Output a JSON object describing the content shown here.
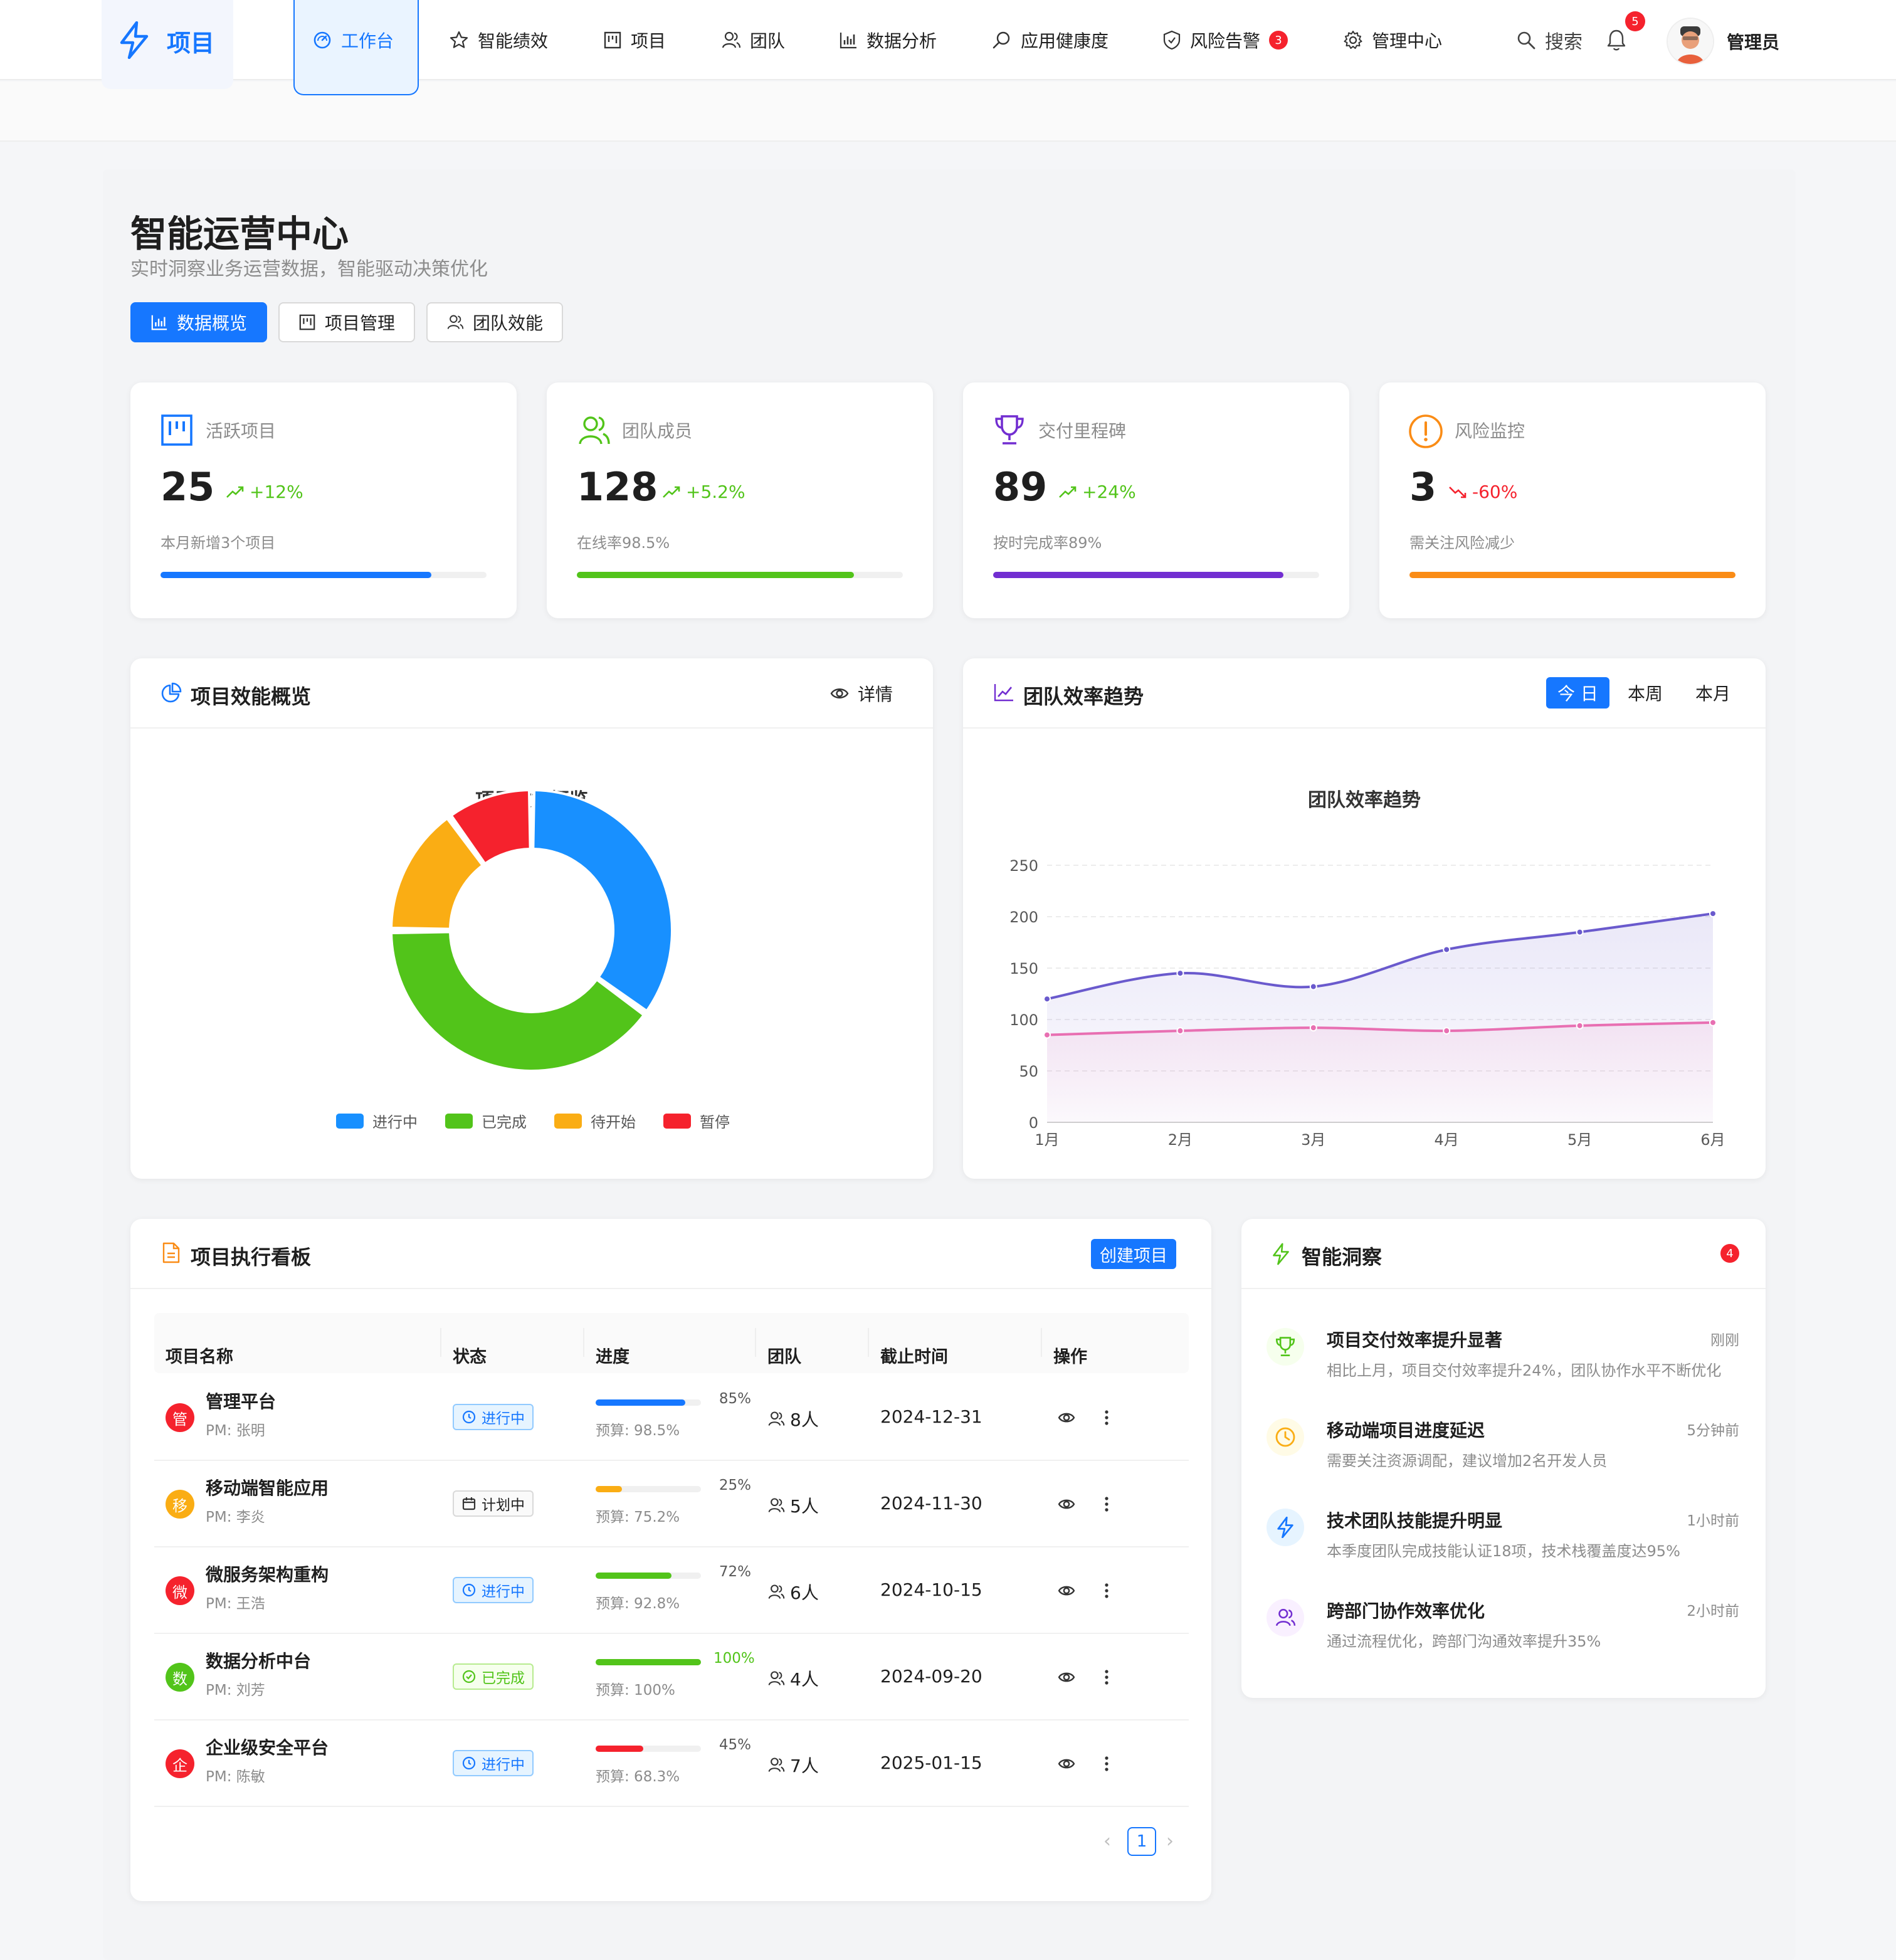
{
  "nav": {
    "logo": "项目",
    "items": [
      {
        "label": "工作台",
        "icon": "dashboard-icon"
      },
      {
        "label": "智能绩效",
        "icon": "star-icon"
      },
      {
        "label": "项目",
        "icon": "project-icon"
      },
      {
        "label": "团队",
        "icon": "team-icon"
      },
      {
        "label": "数据分析",
        "icon": "bar-chart-icon"
      },
      {
        "label": "应用健康度",
        "icon": "monitor-icon"
      },
      {
        "label": "风险告警",
        "icon": "shield-icon",
        "badge": "3"
      },
      {
        "label": "管理中心",
        "icon": "gear-icon"
      }
    ],
    "search": "搜索",
    "bell_badge": "5",
    "user": "管理员",
    "accent": "#1677ff"
  },
  "page": {
    "title": "智能运营中心",
    "subtitle": "实时洞察业务运营数据，智能驱动决策优化",
    "tabs": [
      "数据概览",
      "项目管理",
      "团队效能"
    ]
  },
  "kpis": [
    {
      "label": "活跃项目",
      "value": "25",
      "trend": "+12%",
      "trend_dir": "up",
      "note": "本月新增3个项目",
      "progress": 0.83,
      "color": "#1677ff"
    },
    {
      "label": "团队成员",
      "value": "128",
      "trend": "+5.2%",
      "trend_dir": "up",
      "note": "在线率98.5%",
      "progress": 0.85,
      "color": "#52c41a"
    },
    {
      "label": "交付里程碑",
      "value": "89",
      "trend": "+24%",
      "trend_dir": "up",
      "note": "按时完成率89%",
      "progress": 0.89,
      "color": "#722ed1"
    },
    {
      "label": "风险监控",
      "value": "3",
      "trend": "-60%",
      "trend_dir": "down",
      "note": "需关注风险减少",
      "progress": 1.0,
      "color": "#fa8c16"
    }
  ],
  "overview": {
    "card_title": "项目效能概览",
    "detail_label": "详情"
  },
  "trend": {
    "card_title": "团队效率趋势",
    "ranges": [
      "今 日",
      "本周",
      "本月"
    ],
    "active_range": 0
  },
  "chart_data": [
    {
      "type": "pie",
      "title": "项目效能概览",
      "categories": [
        "进行中",
        "已完成",
        "待开始",
        "暂停"
      ],
      "values": [
        35,
        40,
        15,
        10
      ],
      "colors": [
        "#1890ff",
        "#52c41a",
        "#faad14",
        "#f5222d"
      ],
      "legend": "bottom"
    },
    {
      "type": "area",
      "title": "团队效率趋势",
      "x": [
        "1月",
        "2月",
        "3月",
        "4月",
        "5月",
        "6月"
      ],
      "series": [
        {
          "values": [
            120,
            145,
            132,
            168,
            185,
            203
          ],
          "color": "#6a5acd"
        },
        {
          "values": [
            85,
            89,
            92,
            89,
            94,
            97
          ],
          "color": "#e86fb2"
        }
      ],
      "ylim": [
        0,
        250
      ],
      "yticks": [
        "0",
        "50",
        "100",
        "150",
        "200",
        "250"
      ],
      "grid": true
    }
  ],
  "board": {
    "card_title": "项目执行看板",
    "create_label": "创建项目",
    "columns": [
      "项目名称",
      "状态",
      "进度",
      "团队",
      "截止时间",
      "操作"
    ],
    "rows": [
      {
        "initial": "管",
        "avatar_color": "#f5222d",
        "name": "管理平台",
        "pm": "PM: 张明",
        "status": "进行中",
        "status_kind": "run",
        "progress": 0.85,
        "pct": "85%",
        "bar_color": "#1677ff",
        "budget": "预算: 98.5%",
        "team": "8人",
        "due": "2024-12-31"
      },
      {
        "initial": "移",
        "avatar_color": "#faad14",
        "name": "移动端智能应用",
        "pm": "PM: 李炎",
        "status": "计划中",
        "status_kind": "plan",
        "progress": 0.25,
        "pct": "25%",
        "bar_color": "#faad14",
        "budget": "预算: 75.2%",
        "team": "5人",
        "due": "2024-11-30"
      },
      {
        "initial": "微",
        "avatar_color": "#f5222d",
        "name": "微服务架构重构",
        "pm": "PM: 王浩",
        "status": "进行中",
        "status_kind": "run",
        "progress": 0.72,
        "pct": "72%",
        "bar_color": "#52c41a",
        "budget": "预算: 92.8%",
        "team": "6人",
        "due": "2024-10-15"
      },
      {
        "initial": "数",
        "avatar_color": "#52c41a",
        "name": "数据分析中台",
        "pm": "PM: 刘芳",
        "status": "已完成",
        "status_kind": "done",
        "progress": 1.0,
        "pct": "100%",
        "bar_color": "#52c41a",
        "budget": "预算: 100%",
        "team": "4人",
        "due": "2024-09-20"
      },
      {
        "initial": "企",
        "avatar_color": "#f5222d",
        "name": "企业级安全平台",
        "pm": "PM: 陈敏",
        "status": "进行中",
        "status_kind": "run",
        "progress": 0.45,
        "pct": "45%",
        "bar_color": "#f5222d",
        "budget": "预算: 68.3%",
        "team": "7人",
        "due": "2025-01-15"
      }
    ],
    "page": "1"
  },
  "insights": {
    "card_title": "智能洞察",
    "badge": "4",
    "items": [
      {
        "title": "项目交付效率提升显著",
        "desc": "相比上月，项目交付效率提升24%，团队协作水平不断优化",
        "time": "刚刚",
        "icon": "trophy-icon",
        "color": "#52c41a"
      },
      {
        "title": "移动端项目进度延迟",
        "desc": "需要关注资源调配，建议增加2名开发人员",
        "time": "5分钟前",
        "icon": "clock-icon",
        "color": "#faad14"
      },
      {
        "title": "技术团队技能提升明显",
        "desc": "本季度团队完成技能认证18项，技术栈覆盖度达95%",
        "time": "1小时前",
        "icon": "bolt-icon",
        "color": "#1677ff"
      },
      {
        "title": "跨部门协作效率优化",
        "desc": "通过流程优化，跨部门沟通效率提升35%",
        "time": "2小时前",
        "icon": "team-icon",
        "color": "#722ed1"
      }
    ]
  }
}
